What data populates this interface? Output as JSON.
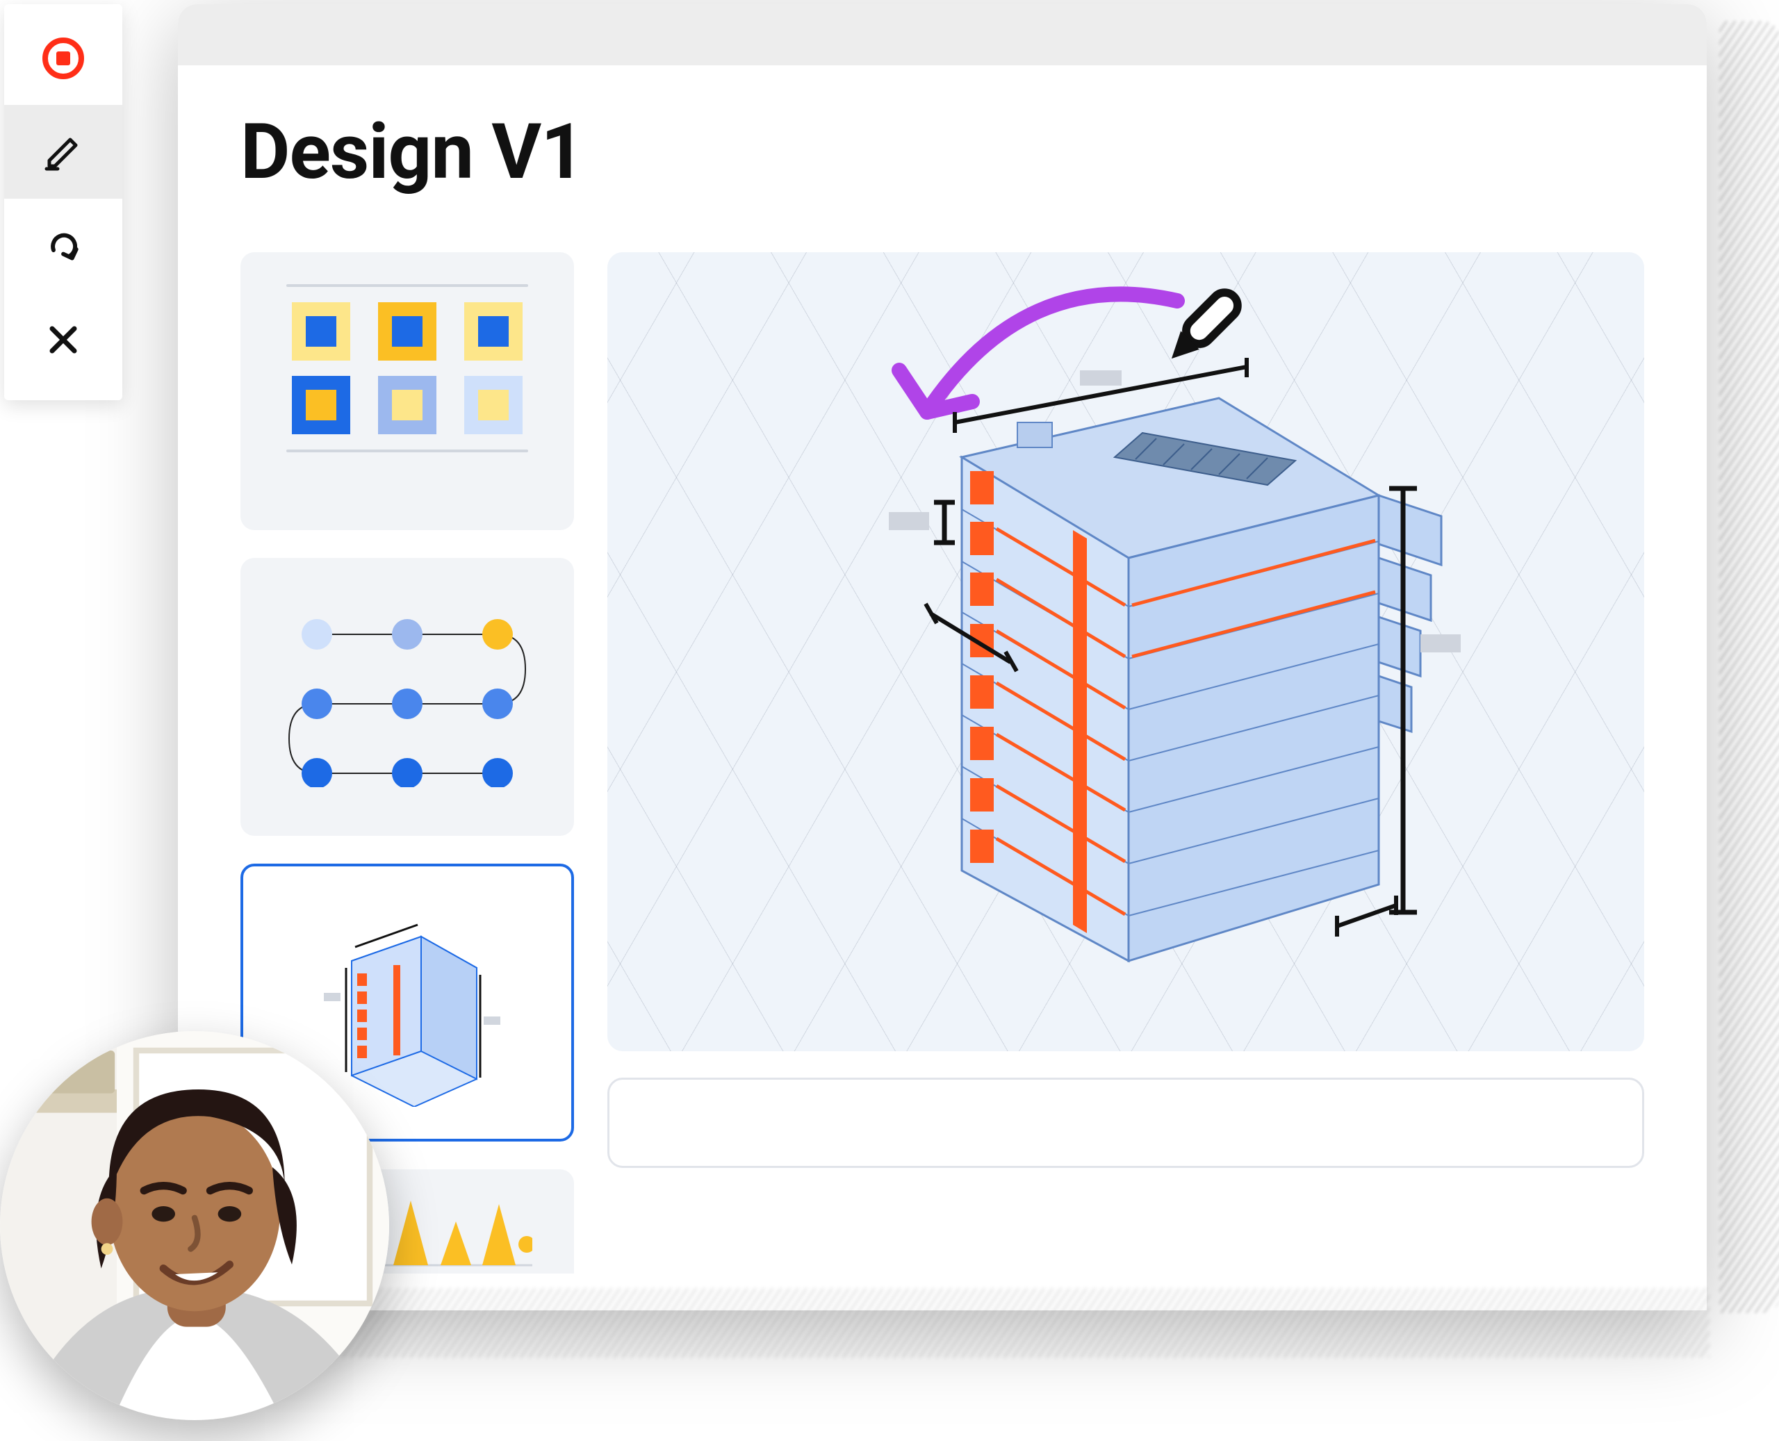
{
  "toolbar": {
    "record_label": "record",
    "edit_label": "edit",
    "redo_label": "redo",
    "close_label": "close"
  },
  "page": {
    "title": "Design V1"
  },
  "thumbs": {
    "palette_label": "Color palette",
    "graph_label": "Flow graph",
    "building_label": "3D building",
    "chart_label": "Spark chart"
  },
  "canvas": {
    "label": "3D building design view",
    "caption_placeholder": ""
  },
  "colors": {
    "accent_blue": "#1d6ae5",
    "yellow": "#fbbf24",
    "orange": "#ff5a1f",
    "purple": "#b044e8"
  },
  "avatar": {
    "label": "Presenter video thumbnail"
  }
}
